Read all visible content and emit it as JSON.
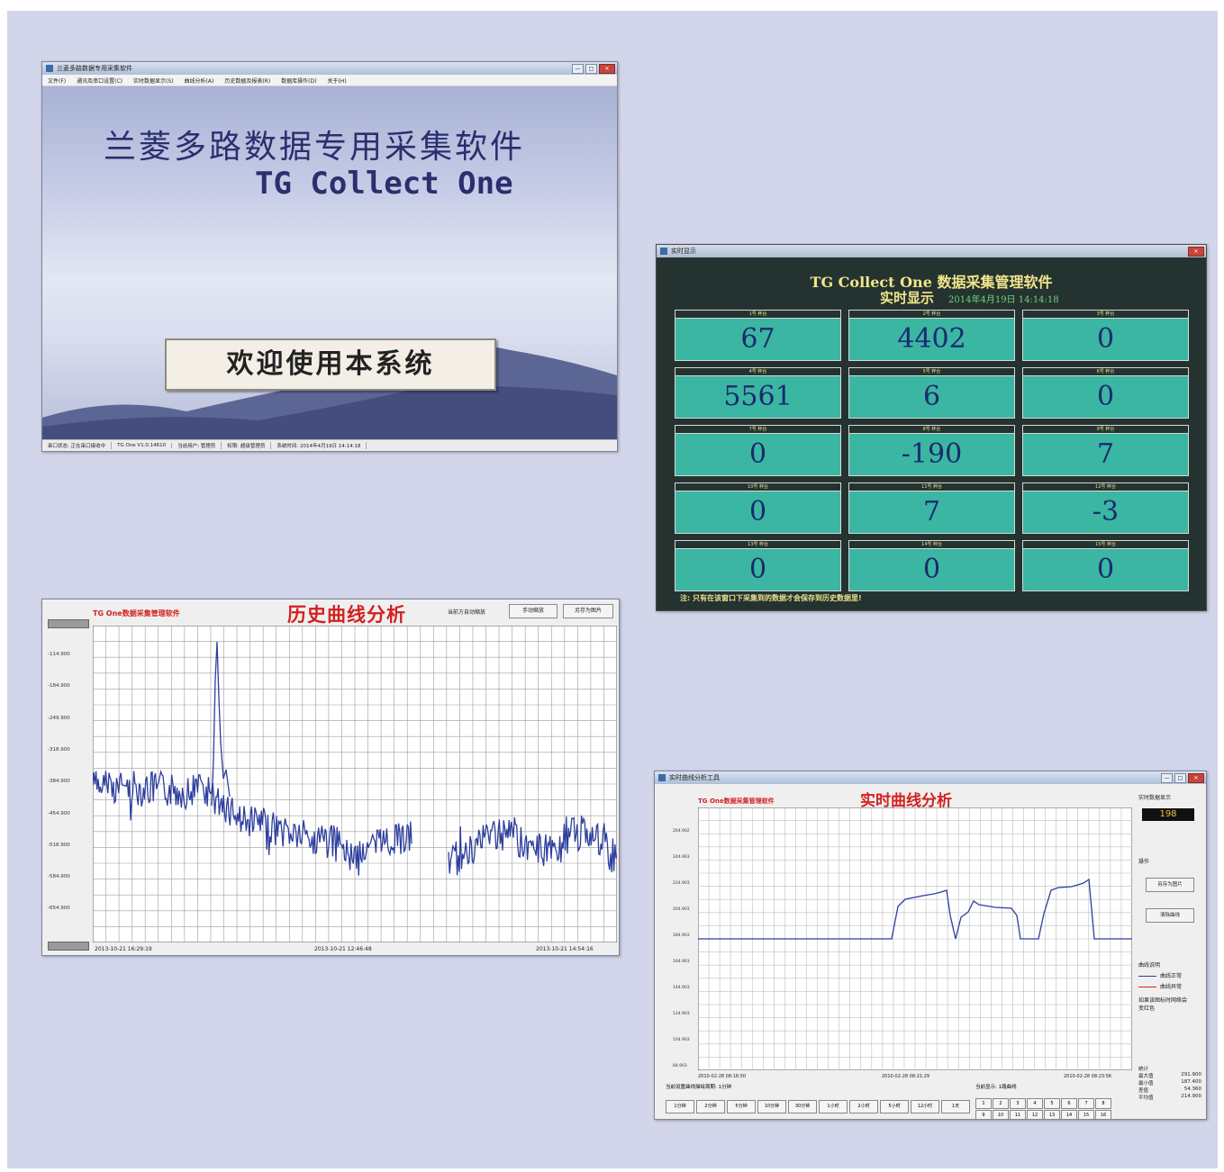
{
  "splash": {
    "window_title": "兰菱多路数据专用采集软件",
    "menu": [
      "文件(F)",
      "通讯及串口设置(C)",
      "实时数据显示(S)",
      "曲线分析(A)",
      "历史数据及报表(R)",
      "数据库操作(D)",
      "关于(H)"
    ],
    "title": "兰菱多路数据专用采集软件",
    "subtitle": "TG Collect One",
    "welcome": "欢迎使用本系统",
    "status": [
      "串口状态: 正在串口接收中",
      "TG One V1.0.14610",
      "当前用户: 管理员",
      "权限: 超级管理员",
      "系统时间: 2014年4月19日 14:14:18"
    ]
  },
  "realtime": {
    "window_title": "实时显示",
    "title": "TG Collect One 数据采集管理软件",
    "subtitle": "实时显示",
    "datetime": "2014年4月19日 14:14:18",
    "cells": [
      {
        "label": "1号 秤台",
        "value": "67"
      },
      {
        "label": "2号 秤台",
        "value": "4402"
      },
      {
        "label": "3号 秤台",
        "value": "0"
      },
      {
        "label": "4号 秤台",
        "value": "5561"
      },
      {
        "label": "5号 秤台",
        "value": "6"
      },
      {
        "label": "6号 秤台",
        "value": "0"
      },
      {
        "label": "7号 秤台",
        "value": "0"
      },
      {
        "label": "8号 秤台",
        "value": "-190"
      },
      {
        "label": "9号 秤台",
        "value": "7"
      },
      {
        "label": "10号 秤台",
        "value": "0"
      },
      {
        "label": "11号 秤台",
        "value": "7"
      },
      {
        "label": "12号 秤台",
        "value": "-3"
      },
      {
        "label": "13号 秤台",
        "value": "0"
      },
      {
        "label": "14号 秤台",
        "value": "0"
      },
      {
        "label": "15号 秤台",
        "value": "0"
      }
    ],
    "note": "注: 只有在该窗口下采集到的数据才会保存到历史数据里!"
  },
  "history": {
    "app_label": "TG One数据采集管理软件",
    "title": "历史曲线分析",
    "option": "当前方自动缩放",
    "btn_manual": "手动缩放",
    "btn_save": "另存为图片",
    "yticks": [
      "-114.900",
      "-184.900",
      "-249.900",
      "-318.900",
      "-384.900",
      "-454.900",
      "-518.900",
      "-584.900",
      "-654.900"
    ],
    "xticks": [
      "2013-10-21 16:29:19",
      "2013-10-21 12:46:48",
      "2013-10-21 14:54:16"
    ]
  },
  "realcurve": {
    "window_title": "实时曲线分析工具",
    "app_label": "TG One数据采集管理软件",
    "title": "实时曲线分析",
    "rt_label": "实时数据显示",
    "rt_value": "198",
    "ops_label": "操作",
    "btn_save": "另存为图片",
    "btn_clear": "清除曲线",
    "legend_title": "曲线说明",
    "legend_normal": "曲线正常",
    "legend_abnormal": "曲线异常",
    "legend_note": "如果该图标时网络会变红色",
    "yticks": [
      "264.902",
      "244.903",
      "224.903",
      "204.903",
      "184.903",
      "164.903",
      "144.903",
      "124.903",
      "104.903",
      "84.903"
    ],
    "xticks": [
      "2010-02-28 08:16:50",
      "2010-02-28 08:21:29",
      "2010-02-28 08:23:56"
    ],
    "period_label": "当前设置曲线描绘周期: 1分钟",
    "periods": [
      "1分钟",
      "2分钟",
      "5分钟",
      "10分钟",
      "30分钟",
      "1小时",
      "2小时",
      "5小时",
      "12小时",
      "1天"
    ],
    "channel_label": "当前显示: 1路曲线",
    "channels_row1": [
      "1",
      "2",
      "3",
      "4",
      "5",
      "6",
      "7",
      "8"
    ],
    "channels_row2": [
      "9",
      "10",
      "11",
      "12",
      "13",
      "14",
      "15",
      "16"
    ],
    "stats_title": "统计",
    "stats": [
      {
        "k": "最大值",
        "v": "291.900"
      },
      {
        "k": "最小值",
        "v": "187.400"
      },
      {
        "k": "差值",
        "v": "54.360"
      },
      {
        "k": "平均值",
        "v": "214.900"
      }
    ]
  }
}
